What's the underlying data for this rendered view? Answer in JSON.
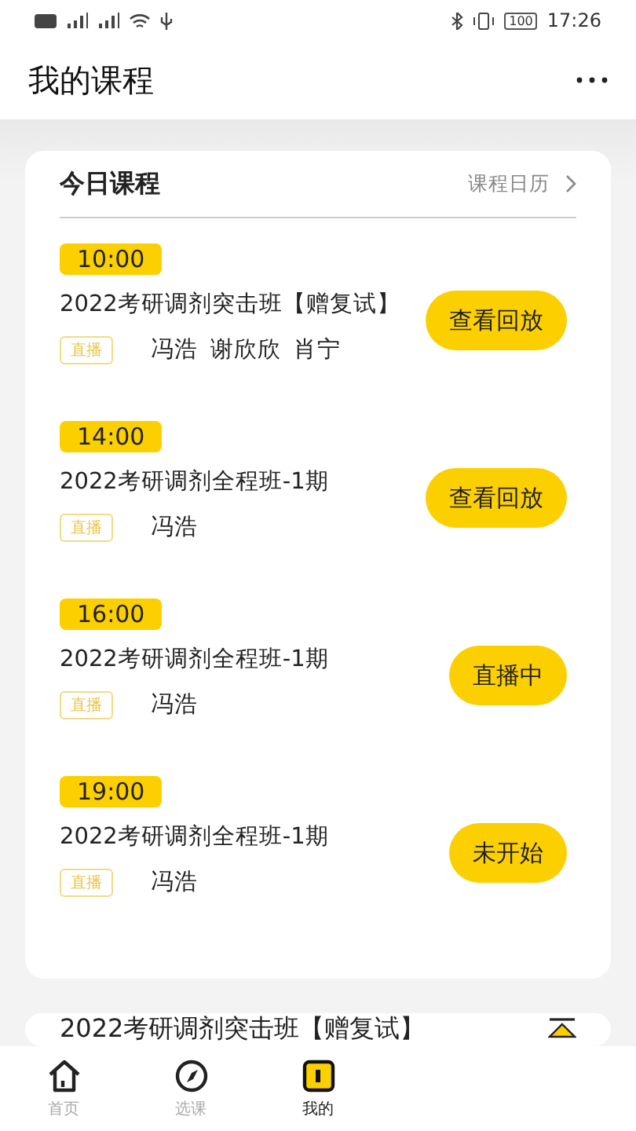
{
  "status_bar": {
    "battery": "100",
    "time": "17:26"
  },
  "header": {
    "title": "我的课程"
  },
  "today": {
    "title": "今日课程",
    "calendar_link": "课程日历",
    "lessons": [
      {
        "time": "10:00",
        "title": "2022考研调剂突击班【赠复试】",
        "tag": "直播",
        "teachers": [
          "冯浩",
          "谢欣欣",
          "肖宁"
        ],
        "action": "查看回放"
      },
      {
        "time": "14:00",
        "title": "2022考研调剂全程班-1期",
        "tag": "直播",
        "teachers": [
          "冯浩"
        ],
        "action": "查看回放"
      },
      {
        "time": "16:00",
        "title": "2022考研调剂全程班-1期",
        "tag": "直播",
        "teachers": [
          "冯浩"
        ],
        "action": "直播中"
      },
      {
        "time": "19:00",
        "title": "2022考研调剂全程班-1期",
        "tag": "直播",
        "teachers": [
          "冯浩"
        ],
        "action": "未开始"
      }
    ]
  },
  "next_card": {
    "title": "2022考研调剂突击班【赠复试】"
  },
  "tab_bar": [
    {
      "kind": "home",
      "label": "首页",
      "selected": false
    },
    {
      "kind": "explore",
      "label": "选课",
      "selected": false
    },
    {
      "kind": "courses",
      "label": "我的",
      "selected": true
    }
  ]
}
